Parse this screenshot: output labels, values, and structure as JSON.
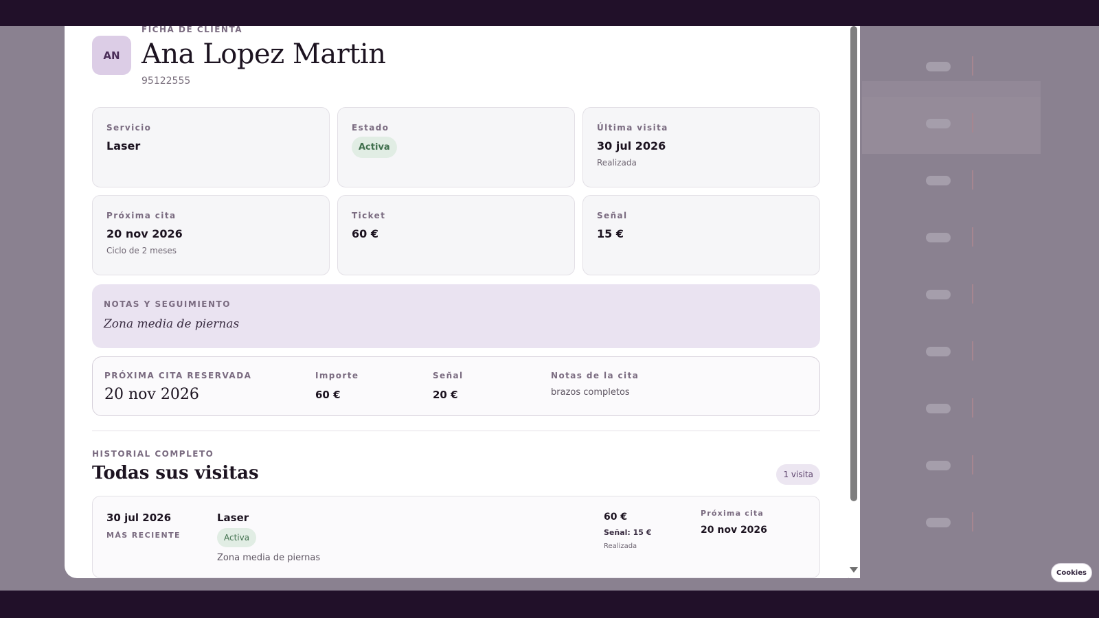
{
  "header": {
    "eyebrow": "FICHA DE CLIENTA",
    "initials": "AN",
    "name": "Ana Lopez Martin",
    "phone": "95122555"
  },
  "cards": {
    "service": {
      "label": "Servicio",
      "value": "Laser"
    },
    "status": {
      "label": "Estado",
      "badge": "Activa"
    },
    "last_visit": {
      "label": "Última visita",
      "value": "30 jul 2026",
      "sub": "Realizada"
    },
    "next_appt": {
      "label": "Próxima cita",
      "value": "20 nov 2026",
      "sub": "Ciclo de 2 meses"
    },
    "ticket": {
      "label": "Ticket",
      "value": "60 €"
    },
    "deposit": {
      "label": "Señal",
      "value": "15 €"
    }
  },
  "notes": {
    "label": "NOTAS Y SEGUIMIENTO",
    "text": "Zona media de piernas"
  },
  "next_booked": {
    "label": "PRÓXIMA CITA RESERVADA",
    "date": "20 nov 2026",
    "amount_label": "Importe",
    "amount": "60 €",
    "deposit_label": "Señal",
    "deposit": "20 €",
    "notes_label": "Notas de la cita",
    "notes": "brazos completos"
  },
  "history": {
    "eyebrow": "HISTORIAL COMPLETO",
    "title": "Todas sus visitas",
    "count": "1 visita",
    "visits": [
      {
        "date": "30 jul 2026",
        "tag": "MÁS RECIENTE",
        "service": "Laser",
        "badge": "Activa",
        "note": "Zona media de piernas",
        "amount": "60 €",
        "deposit": "Señal: 15 €",
        "status": "Realizada",
        "next_label": "Próxima cita",
        "next_date": "20 nov 2026"
      }
    ]
  },
  "cookies": {
    "label": "Cookies"
  },
  "colors": {
    "backdrop": "#211029",
    "accent": "#eae3f1",
    "badge_bg": "#e1ede4",
    "badge_text": "#3f6f4c"
  },
  "icons": [
    "scroll-down-icon"
  ]
}
